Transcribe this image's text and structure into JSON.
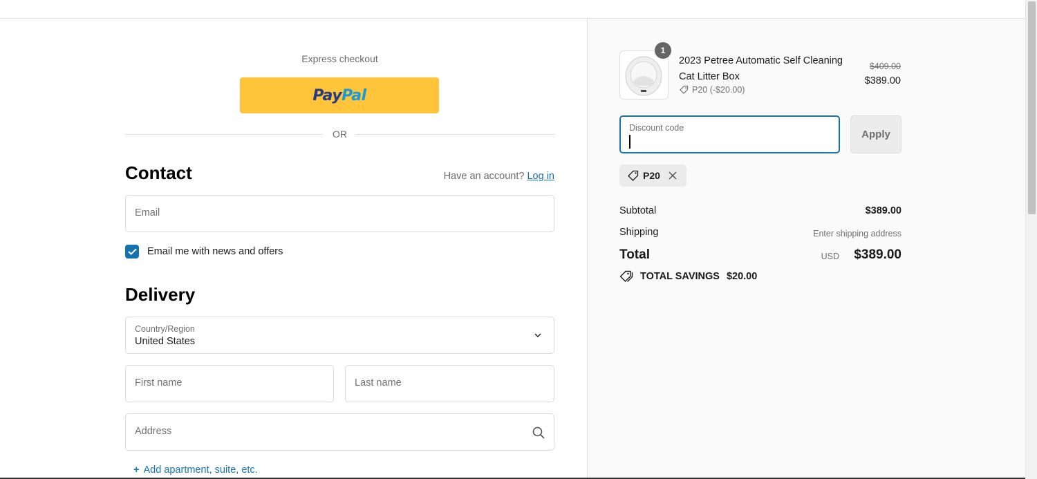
{
  "express": {
    "label": "Express checkout",
    "paypal_part1": "Pay",
    "paypal_part2": "Pal"
  },
  "divider": {
    "or_text": "OR"
  },
  "contact": {
    "heading": "Contact",
    "have_account": "Have an account?",
    "login_link": "Log in",
    "email_placeholder": "Email",
    "newsletter_label": "Email me with news and offers",
    "newsletter_checked": true
  },
  "delivery": {
    "heading": "Delivery",
    "country_label": "Country/Region",
    "country_value": "United States",
    "first_name_placeholder": "First name",
    "last_name_placeholder": "Last name",
    "address_placeholder": "Address",
    "add_apartment": "Add apartment, suite, etc."
  },
  "order": {
    "product": {
      "quantity": "1",
      "name": "2023 Petree Automatic Self Cleaning Cat Litter Box",
      "discount_line": "P20 (-$20.00)",
      "old_price": "$409.00",
      "new_price": "$389.00"
    },
    "discount_input_label": "Discount code",
    "apply_label": "Apply",
    "applied_code": "P20",
    "subtotal_label": "Subtotal",
    "subtotal_value": "$389.00",
    "shipping_label": "Shipping",
    "shipping_value": "Enter shipping address",
    "total_label": "Total",
    "currency": "USD",
    "total_value": "$389.00",
    "savings_label": "TOTAL SAVINGS",
    "savings_value": "$20.00"
  },
  "colors": {
    "accent": "#1773b0",
    "paypal_yellow": "#ffc439",
    "sidebar_bg": "#fafafa"
  }
}
